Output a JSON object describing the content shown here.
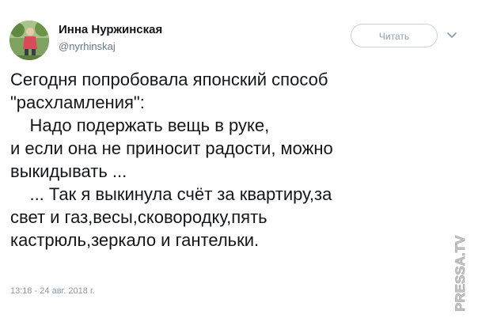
{
  "author": {
    "display_name": "Инна Нуржинская",
    "handle": "@nyrhinskaj"
  },
  "follow_button": {
    "label": "Читать"
  },
  "tweet": {
    "text": "Сегодня попробовала японский способ\n\"расхламления\":\n    Надо подержать вещь в руке,\nи если она не приносит радости, можно\nвыкидывать ...\n    ... Так я выкинула счёт за квартиру,за\nсвет и газ,весы,сковородку,пять\nкастрюль,зеркало и гантельки.",
    "timestamp": "13:18 - 24 авг. 2018 г."
  },
  "watermark": {
    "text": "PRESSA.TV"
  },
  "icons": {
    "avatar": "profile-photo",
    "menu": "chevron-down-icon"
  },
  "colors": {
    "text": "#14171a",
    "secondary": "#657786",
    "button_border": "#c8d4de",
    "button_text": "#8fa1b1"
  }
}
